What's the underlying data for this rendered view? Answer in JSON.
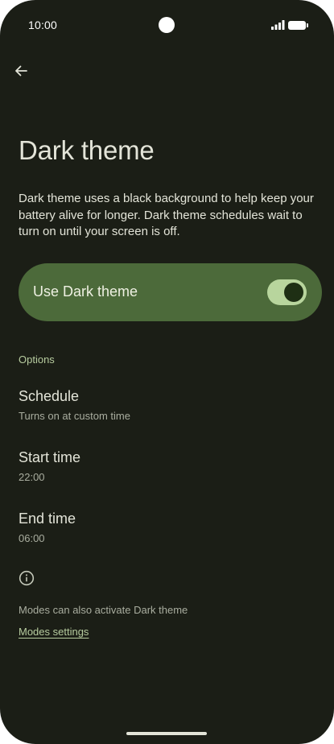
{
  "status_bar": {
    "time": "10:00",
    "icons": [
      "signal-icon",
      "battery-icon"
    ]
  },
  "header": {
    "back_icon": "arrow-back-icon",
    "title": "Dark theme"
  },
  "description": "Dark theme uses a black background to help keep your battery alive for longer. Dark theme schedules wait to turn on until your screen is off.",
  "main_toggle": {
    "label": "Use Dark theme",
    "checked": true
  },
  "options": {
    "header": "Options",
    "items": [
      {
        "title": "Schedule",
        "summary": "Turns on at custom time"
      },
      {
        "title": "Start time",
        "summary": "22:00"
      },
      {
        "title": "End time",
        "summary": "06:00"
      }
    ]
  },
  "footer": {
    "icon": "info-icon",
    "text": "Modes can also activate Dark theme",
    "link": "Modes settings"
  },
  "colors": {
    "background": "#1b1e16",
    "accent_card": "#4c6a3a",
    "switch_track": "#b8d59d",
    "accent_text": "#b7cc9f"
  }
}
